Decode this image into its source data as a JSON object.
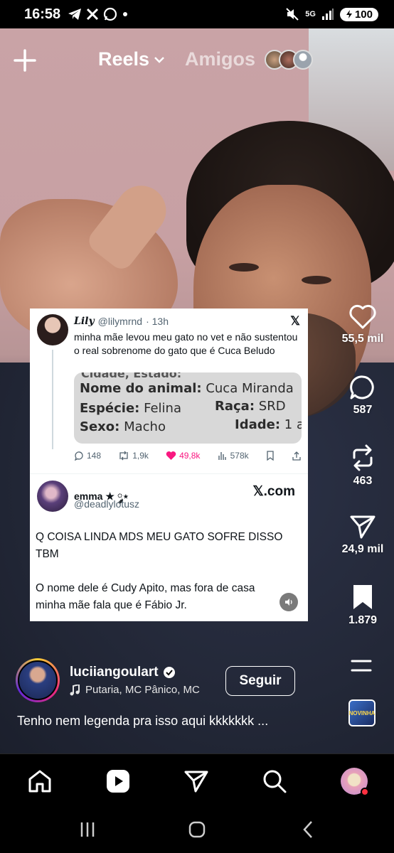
{
  "status_bar": {
    "time": "16:58",
    "notification_icons": [
      "telegram-icon",
      "x-icon",
      "whatsapp-icon",
      "dot-icon"
    ],
    "network": "5G",
    "battery": "100"
  },
  "header": {
    "reels_tab": "Reels",
    "friends_tab": "Amigos"
  },
  "tweet_card": {
    "tweet1": {
      "name": "𝑳𝒊𝒍𝒚",
      "handle": "@lilymrnd",
      "time": "· 13h",
      "text": "minha mãe levou meu gato no vet e não sustentou o real sobrenome do gato que é Cuca Beludo",
      "image": {
        "cut_line": "Cidade, Estado:",
        "name_label": "Nome do animal:",
        "name_value": "Cuca Miranda",
        "species_label": "Espécie:",
        "species_value": "Felina",
        "breed_label": "Raça:",
        "breed_value": "SRD",
        "sex_label": "Sexo:",
        "sex_value": "Macho",
        "age_label": "Idade:",
        "age_value": "1 a"
      },
      "replies": "148",
      "retweets": "1,9k",
      "likes": "49,8k",
      "views": "578k"
    },
    "tweet2": {
      "name": "emma ★ ༘⋆",
      "handle": "@deadlylotusz",
      "xcom": "𝕏.com",
      "text1": "Q COISA LINDA MDS MEU GATO SOFRE DISSO TBM",
      "text2": "O nome dele é Cudy Apito, mas fora de casa minha mãe fala que é Fábio Jr."
    }
  },
  "rail": {
    "likes": "55,5 mil",
    "comments": "587",
    "reposts": "463",
    "shares": "24,9 mil",
    "saves": "1.879"
  },
  "reel_info": {
    "username": "luciiangoulart",
    "music": "Putaria, MC Pânico, MC",
    "follow_label": "Seguir",
    "caption": "Tenho nem legenda pra isso aqui kkkkkkk ...",
    "audio_thumb_text": "NOVINHA"
  },
  "colors": {
    "like_pink": "#f91880",
    "brand_gradient": [
      "#f9ce34",
      "#ee2a7b",
      "#6228d7"
    ]
  }
}
